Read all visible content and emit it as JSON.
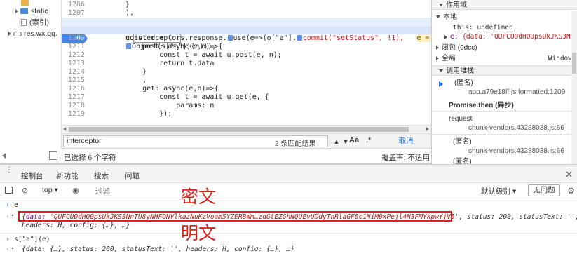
{
  "tree": {
    "items": [
      {
        "label": "static",
        "type": "folder"
      },
      {
        "label": "(索引)",
        "type": "file"
      },
      {
        "label": "res.wx.qq.",
        "type": "cloud"
      }
    ]
  },
  "editor": {
    "lines": [
      {
        "num": "1206",
        "code": "}"
      },
      {
        "num": "1207",
        "code": "),"
      },
      {
        "num": "1208",
        "code_parts": [
          "u.",
          "interceptor",
          "s.response.",
          "use(e=>(o[\"a\"].",
          "commit(\"setStatus\", !1),   ",
          "e = {data"
        ]
      },
      {
        "num": "1209",
        "code": "Object(s[\"a\"])(e))),"
      },
      {
        "num": "1210",
        "code": "const d = {"
      },
      {
        "num": "1211",
        "code": "    post: async(e,n)=>{"
      },
      {
        "num": "1212",
        "code": "        const t = await u.post(e, n);"
      },
      {
        "num": "1213",
        "code": "        return t.data"
      },
      {
        "num": "1214",
        "code": "    }"
      },
      {
        "num": "1215",
        "code": "    ,"
      },
      {
        "num": "1216",
        "code": "    get: async(e,n)=>{"
      },
      {
        "num": "1217",
        "code": "        const t = await u.get(e, {"
      },
      {
        "num": "1218",
        "code": "            params: n"
      },
      {
        "num": "1219",
        "code": "        });"
      }
    ]
  },
  "search": {
    "value": "interceptor",
    "match_count": "2 条匹配结果",
    "case_label": "Aa",
    "regex_label": ".*",
    "cancel_label": "取消"
  },
  "status": {
    "selected": "已选择 6 个字符",
    "coverage": "覆盖率: 不适用"
  },
  "scope_panel": {
    "scope_header": "作用域",
    "local_label": "本地",
    "this_line": "this: undefined",
    "e_line_key": "e:",
    "e_line_val": "{data: 'QUFCU0dHQ0psUkJKS3NnT",
    "closure_label": "闭包 (0dcc)",
    "global_label": "全局",
    "global_value": "Window",
    "callstack_header": "调用堆栈",
    "frames": [
      {
        "name": "(匿名)",
        "src": "app.a79e18ff.js:formatted:1209"
      },
      {
        "name": "Promise.then (异步)",
        "src": ""
      },
      {
        "name": "request",
        "src": "chunk-vendors.43288038.js:66"
      },
      {
        "name": "(匿名)",
        "src": "chunk-vendors.43288038.js:66"
      },
      {
        "name": "(匿名)",
        "src": ""
      }
    ]
  },
  "drawer": {
    "tabs": [
      "控制台",
      "新功能",
      "搜索",
      "问题"
    ]
  },
  "console_toolbar": {
    "context": "top",
    "filter_placeholder": "过滤",
    "levels": "默认级别",
    "issues": "无问题"
  },
  "console": {
    "input1": "e",
    "output1_key": "data:",
    "output1_enc": "'QUFCU0dHQ0psUkJKS3NnTU8yNHFONVlkazNuKzVoam5YZERBWm…zdGtEZGhNQUEvUDdyTnRlaGF6c1NiM0xPejl4N3FMYkpwYjV5'",
    "output1_rest": ", status: 200, statusText: '', h",
    "output1_line2": "headers: H, config: {…}, …}",
    "input2": "s[\"a\"](e)",
    "output2": "{data: {…}, status: 200, statusText: '', headers: H, config: {…}, …}"
  },
  "annotations": {
    "encrypted": "密文",
    "plaintext": "明文"
  },
  "colors": {
    "accent": "#1a73e8",
    "breakpoint": "#4285f4",
    "annotation_red": "#e0201a"
  }
}
